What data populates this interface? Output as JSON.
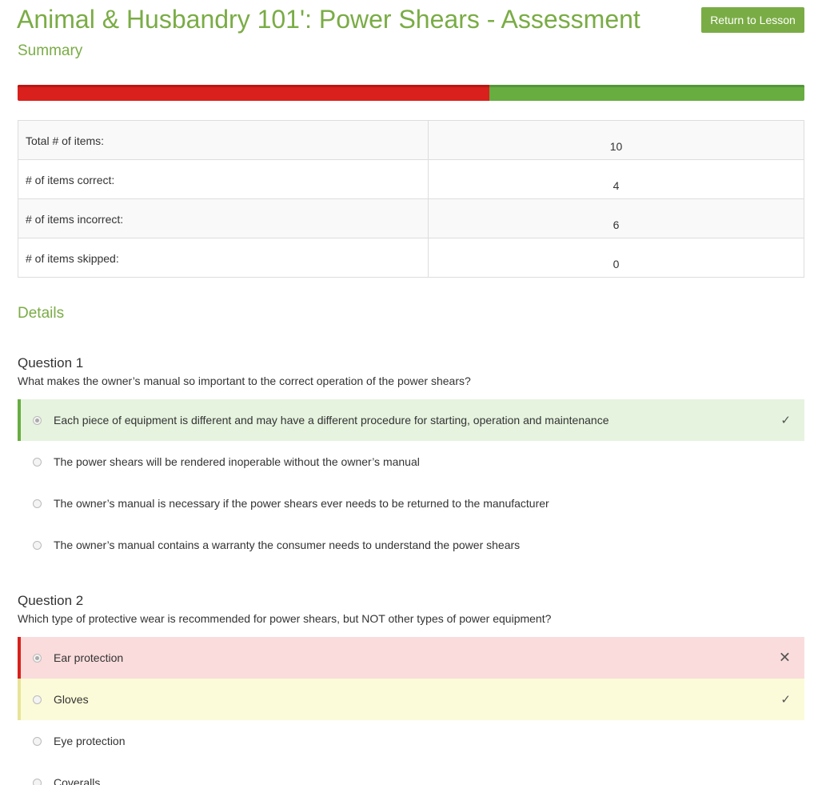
{
  "header": {
    "title": "Animal & Husbandry 101': Power Shears - Assessment",
    "return_label": "Return to Lesson"
  },
  "summary": {
    "heading": "Summary",
    "progress": {
      "incorrect_fraction": 0.6,
      "correct_fraction": 0.4,
      "incorrect_color": "#d9201c",
      "correct_color": "#67ad40"
    },
    "rows": [
      {
        "label": "Total # of items:",
        "value": "10"
      },
      {
        "label": "# of items correct:",
        "value": "4"
      },
      {
        "label": "# of items incorrect:",
        "value": "6"
      },
      {
        "label": "# of items skipped:",
        "value": "0"
      }
    ]
  },
  "details": {
    "heading": "Details",
    "questions": [
      {
        "title": "Question 1",
        "prompt": "What makes the owner’s manual so important to the correct operation of the power shears?",
        "options": [
          {
            "text": "Each piece of equipment is different and may have a different procedure for starting, operation and maintenance",
            "state": "correct-chosen",
            "mark": "✓"
          },
          {
            "text": "The power shears will be rendered inoperable without the owner’s manual",
            "state": "none",
            "mark": ""
          },
          {
            "text": "The owner’s manual is necessary if the power shears ever needs to be returned to the manufacturer",
            "state": "none",
            "mark": ""
          },
          {
            "text": "The owner’s manual contains a warranty the consumer needs to understand the power shears",
            "state": "none",
            "mark": ""
          }
        ]
      },
      {
        "title": "Question 2",
        "prompt": "Which type of protective wear is recommended for power shears, but NOT other types of power equipment?",
        "options": [
          {
            "text": "Ear protection",
            "state": "incorrect-chosen",
            "mark": "✕"
          },
          {
            "text": "Gloves",
            "state": "missed",
            "mark": "✓"
          },
          {
            "text": "Eye protection",
            "state": "none",
            "mark": ""
          },
          {
            "text": "Coveralls",
            "state": "none",
            "mark": ""
          }
        ]
      }
    ]
  }
}
